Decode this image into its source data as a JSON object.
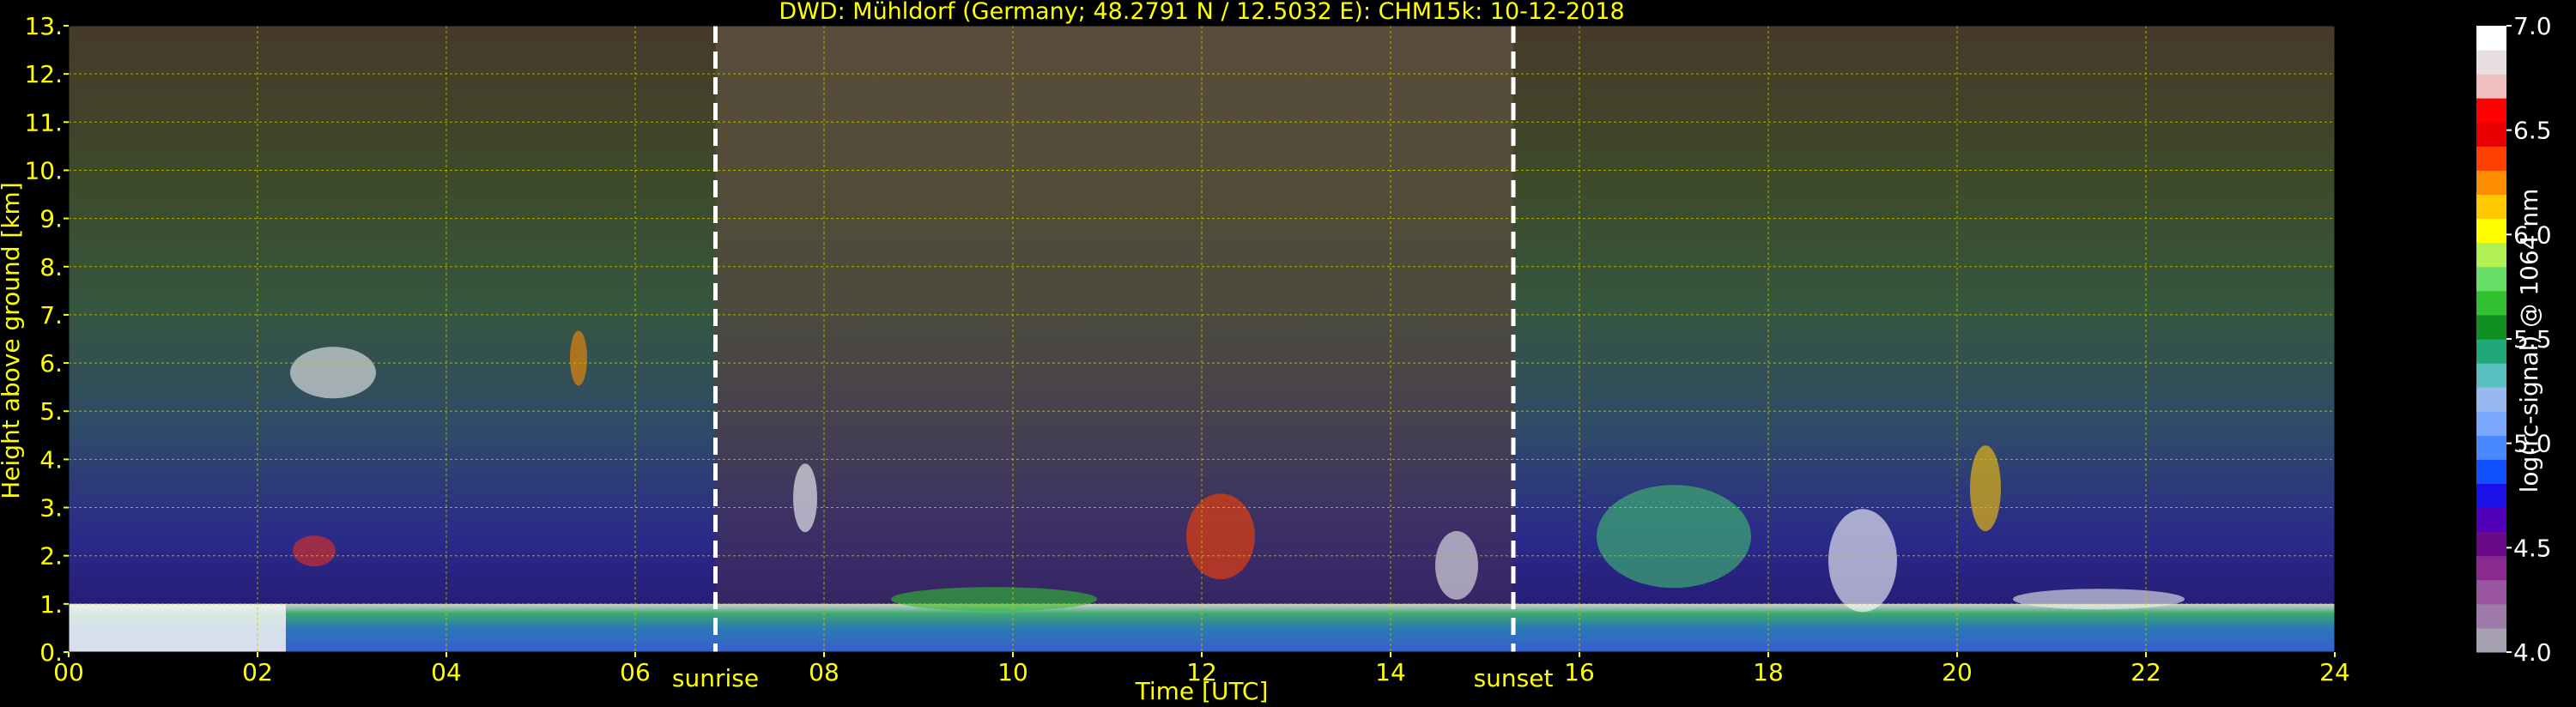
{
  "chart_data": {
    "type": "heatmap",
    "title": "DWD: Mühldorf (Germany; 48.2791 N / 12.5032 E):    CHM15k: 10-12-2018",
    "xlabel": "Time [UTC]",
    "ylabel": "Height above ground [km]",
    "xlim": [
      0,
      24
    ],
    "ylim": [
      0,
      13
    ],
    "x_tick_labels": [
      "00",
      "02",
      "04",
      "06",
      "08",
      "10",
      "12",
      "14",
      "16",
      "18",
      "20",
      "22",
      "24"
    ],
    "y_tick_labels": [
      "0.",
      "1.",
      "2.",
      "3.",
      "4.",
      "5.",
      "6.",
      "7.",
      "8.",
      "9.",
      "10.",
      "11.",
      "12.",
      "13."
    ],
    "grid": true,
    "markers": [
      {
        "label": "sunrise",
        "x": 6.85
      },
      {
        "label": "sunset",
        "x": 15.3
      }
    ],
    "colorbar": {
      "label": "log(rc-signal) @ 1064 nm",
      "range": [
        4.0,
        7.0
      ],
      "tick_labels": [
        "4.0",
        "4.5",
        "5.0",
        "5.5",
        "6.0",
        "6.5",
        "7.0"
      ],
      "colors": [
        "#a7a0b0",
        "#9e7aa8",
        "#9a55a0",
        "#8a2a90",
        "#6a0a8a",
        "#5000b8",
        "#1a10e8",
        "#1050ff",
        "#4a88ff",
        "#7aa8ff",
        "#9ab8f0",
        "#58c0c0",
        "#20a878",
        "#109020",
        "#30c030",
        "#68e068",
        "#b0f050",
        "#ffff00",
        "#ffc800",
        "#ff8c00",
        "#ff4000",
        "#e80000",
        "#ff0000",
        "#f0c0c0",
        "#e8e0e0",
        "#ffffff"
      ]
    },
    "series": []
  },
  "colors": {
    "text_accent": "#ffff00",
    "grid": "#c8c800",
    "marker": "#ffffff",
    "background": "#000000"
  }
}
